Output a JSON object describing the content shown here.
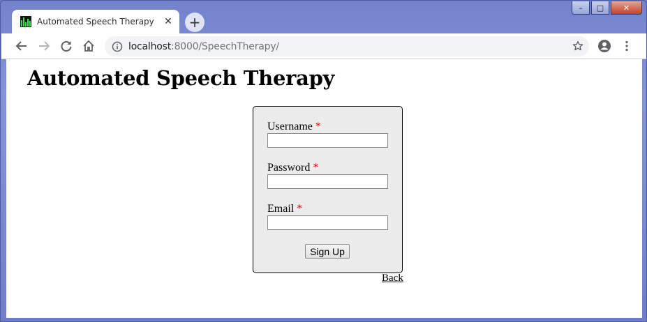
{
  "browser": {
    "tab": {
      "title": "Automated Speech Therapy",
      "close_glyph": "✕"
    },
    "new_tab_glyph": "+",
    "url": {
      "host": "localhost",
      "rest": ":8000/SpeechTherapy/"
    },
    "icons": {
      "back": "arrow-left-icon",
      "forward": "arrow-right-icon",
      "reload": "reload-icon",
      "home": "home-icon",
      "info": "info-icon",
      "bookmark": "star-icon",
      "profile": "account-circle-icon",
      "menu": "kebab-menu-icon"
    },
    "window_controls": {
      "minimize": "–",
      "maximize": "□",
      "close": "✕"
    }
  },
  "page": {
    "title": "Automated Speech Therapy",
    "form": {
      "fields": [
        {
          "label": "Username",
          "required_mark": "*",
          "value": ""
        },
        {
          "label": "Password",
          "required_mark": "*",
          "value": ""
        },
        {
          "label": "Email",
          "required_mark": "*",
          "value": ""
        }
      ],
      "submit_label": "Sign Up"
    },
    "back_link": "Back"
  },
  "colors": {
    "required": "#e00000",
    "form_background": "#ececec",
    "window_frame": "#7383cc"
  }
}
